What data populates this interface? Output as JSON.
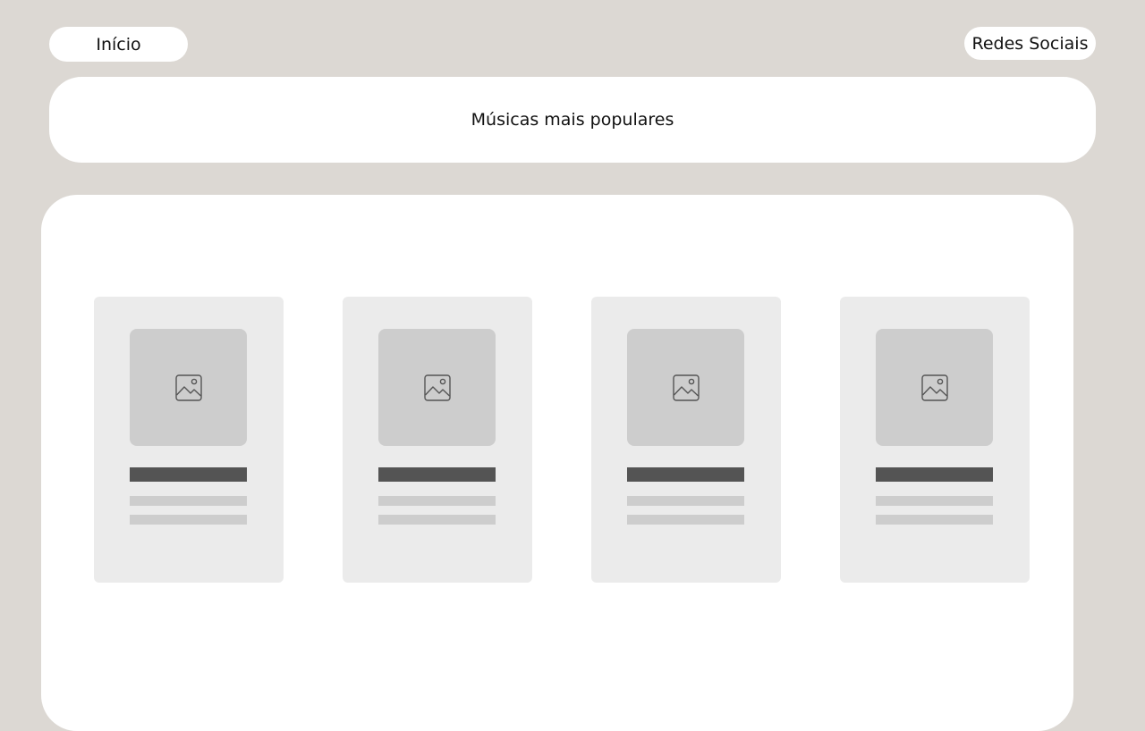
{
  "nav": {
    "home_label": "Início",
    "social_label": "Redes Sociais"
  },
  "header": {
    "title": "Músicas mais populares"
  },
  "cards": [
    {
      "image_icon": "image-placeholder-icon"
    },
    {
      "image_icon": "image-placeholder-icon"
    },
    {
      "image_icon": "image-placeholder-icon"
    },
    {
      "image_icon": "image-placeholder-icon"
    }
  ],
  "colors": {
    "page_background": "#dcd8d3",
    "surface": "#ffffff",
    "card_background": "#ebebeb",
    "placeholder": "#cdcdcd",
    "title_bar": "#545454"
  }
}
